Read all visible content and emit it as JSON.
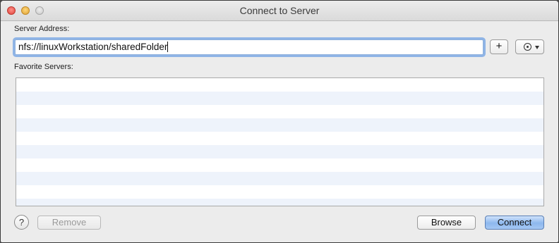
{
  "window": {
    "title": "Connect to Server"
  },
  "server_address": {
    "label": "Server Address:",
    "value": "nfs://linuxWorkstation/sharedFolder",
    "add_label": "+"
  },
  "favorites": {
    "label": "Favorite Servers:",
    "items": []
  },
  "footer": {
    "help_label": "?",
    "remove_label": "Remove",
    "browse_label": "Browse",
    "connect_label": "Connect"
  },
  "icons": {
    "action_menu": "gear-icon",
    "action_arrow": "chevron-down-icon"
  },
  "colors": {
    "accent": "#8db8ee",
    "focus_ring": "#8fb4e6",
    "alt_row": "#eef3fb"
  }
}
